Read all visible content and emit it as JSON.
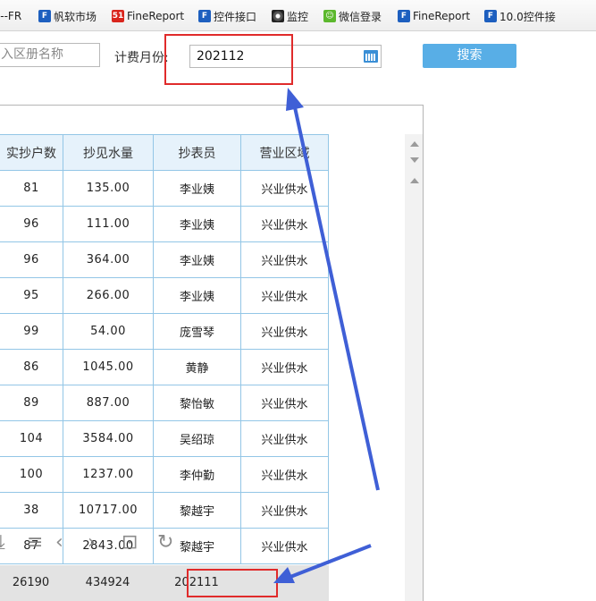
{
  "bookmarks": [
    {
      "label": "s--FR",
      "icon": "none"
    },
    {
      "label": "帆软市场",
      "icon": "fanruan-logo-icon"
    },
    {
      "label": "FineReport",
      "icon": "51-logo-icon"
    },
    {
      "label": "控件接口",
      "icon": "fanruan-logo-icon"
    },
    {
      "label": "监控",
      "icon": "camera-icon"
    },
    {
      "label": "微信登录",
      "icon": "wechat-icon"
    },
    {
      "label": "FineReport",
      "icon": "fanruan-logo-icon"
    },
    {
      "label": "10.0控件接",
      "icon": "fanruan-logo-icon"
    }
  ],
  "query": {
    "area_placeholder": "入区册名称",
    "month_label": "计费月份:",
    "month_value": "202112",
    "search_label": "搜索"
  },
  "table": {
    "headers": [
      "实抄户数",
      "抄见水量",
      "抄表员",
      "营业区域"
    ],
    "rows": [
      [
        "81",
        "135.00",
        "李业姨",
        "兴业供水"
      ],
      [
        "96",
        "111.00",
        "李业姨",
        "兴业供水"
      ],
      [
        "96",
        "364.00",
        "李业姨",
        "兴业供水"
      ],
      [
        "95",
        "266.00",
        "李业姨",
        "兴业供水"
      ],
      [
        "99",
        "54.00",
        "庞雪琴",
        "兴业供水"
      ],
      [
        "86",
        "1045.00",
        "黄静",
        "兴业供水"
      ],
      [
        "89",
        "887.00",
        "黎怡敏",
        "兴业供水"
      ],
      [
        "104",
        "3584.00",
        "吴绍琼",
        "兴业供水"
      ],
      [
        "100",
        "1237.00",
        "李仲勤",
        "兴业供水"
      ],
      [
        "38",
        "10717.00",
        "黎越宇",
        "兴业供水"
      ],
      [
        "87",
        "2843.00",
        "黎越宇",
        "兴业供水"
      ]
    ],
    "totals": [
      "26190",
      "434924",
      "202111"
    ]
  },
  "colors": {
    "accent": "#58aee6",
    "highlight": "#e02b2b",
    "arrow": "#3f5fd6",
    "grid": "#93c6e6"
  }
}
